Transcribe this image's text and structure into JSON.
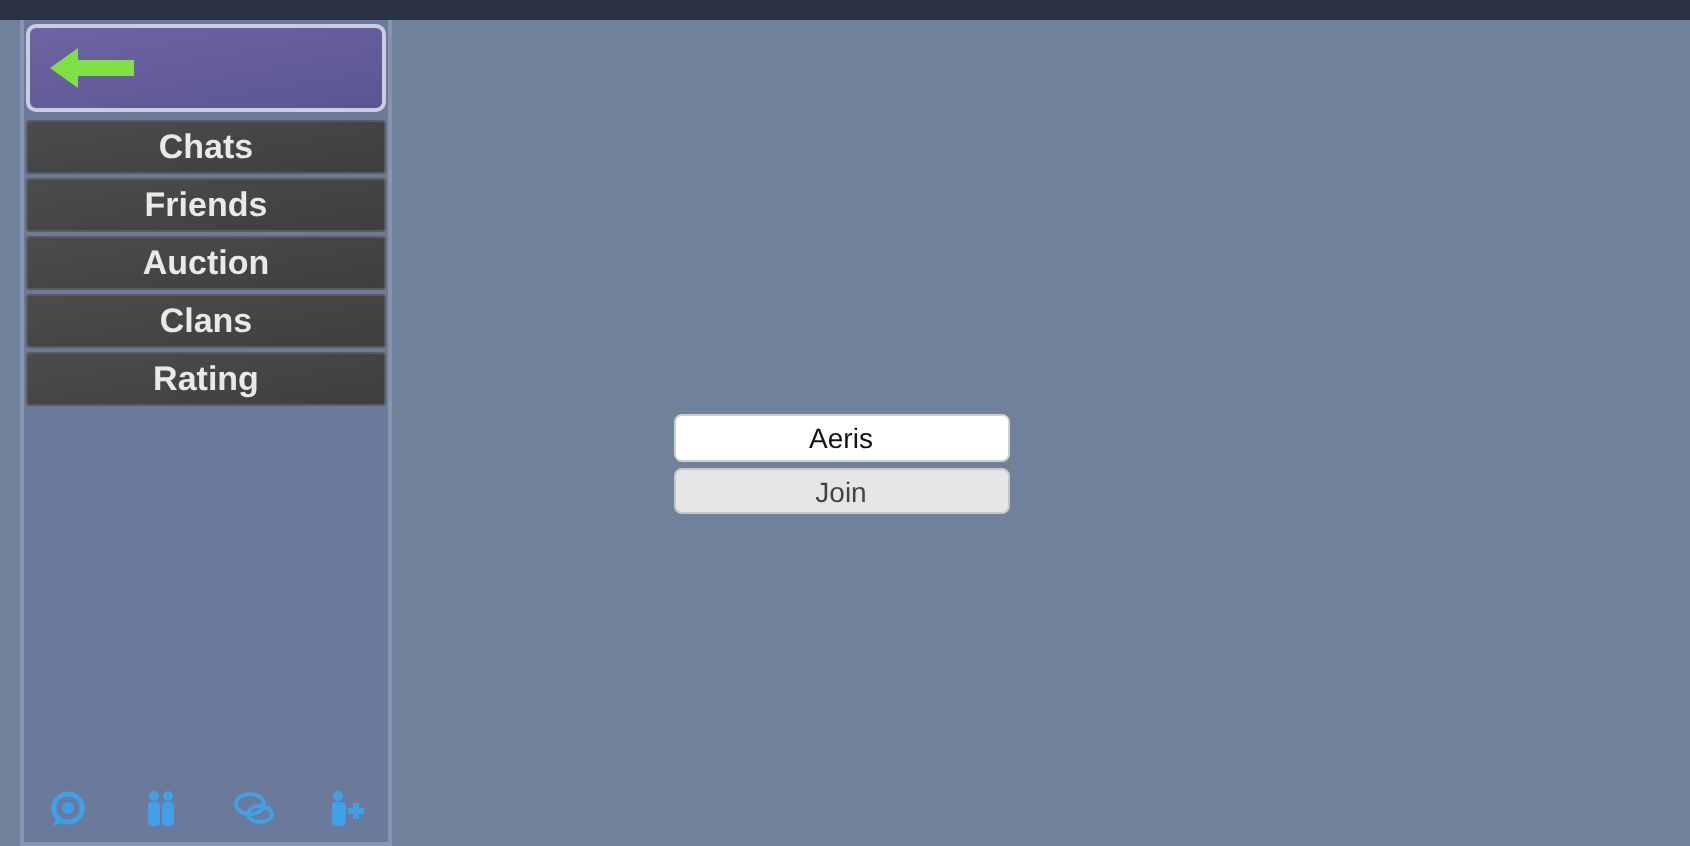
{
  "menu": [
    {
      "label": "Chats"
    },
    {
      "label": "Friends"
    },
    {
      "label": "Auction"
    },
    {
      "label": "Clans"
    },
    {
      "label": "Rating"
    }
  ],
  "name_field": {
    "value": "Aeris"
  },
  "join_button": {
    "label": "Join"
  },
  "bottom_icons": [
    {
      "kind": "chat-bubble"
    },
    {
      "kind": "people"
    },
    {
      "kind": "speech-bubbles"
    },
    {
      "kind": "person-add"
    }
  ]
}
